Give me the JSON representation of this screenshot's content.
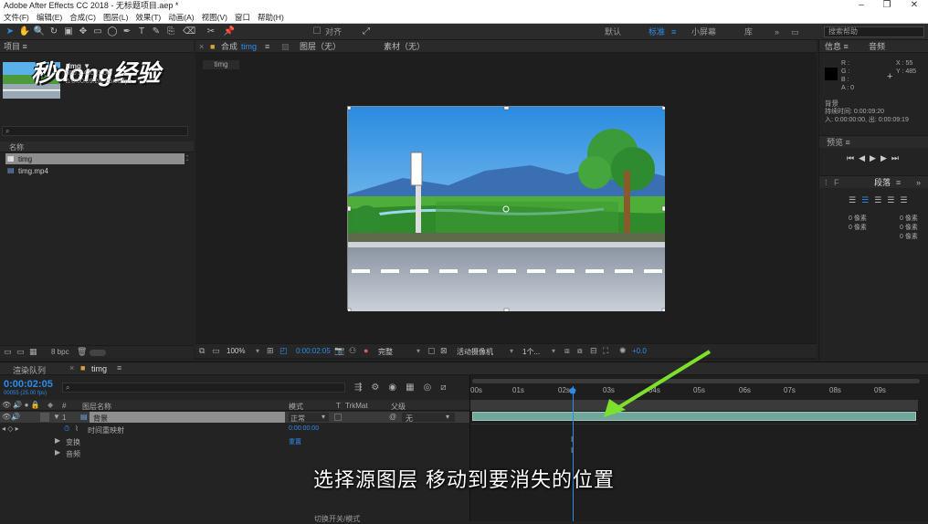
{
  "window": {
    "title": "Adobe After Effects CC 2018 - 无标题项目.aep *"
  },
  "menu": [
    "文件(F)",
    "编辑(E)",
    "合成(C)",
    "图层(L)",
    "效果(T)",
    "动画(A)",
    "视图(V)",
    "窗口",
    "帮助(H)"
  ],
  "toolbar": {
    "align_label": "对齐",
    "workspaces": [
      "默认",
      "标准",
      "小屏幕",
      "库"
    ],
    "search_placeholder": "搜索帮助"
  },
  "project": {
    "tab": "项目",
    "item_name": "timg ▼",
    "item_dims": "650 x 420 (1.00)",
    "item_dur": "Δ 0:00:09:20, 25.00 fps",
    "name_header": "名称",
    "items": [
      "timg",
      "timg.mp4"
    ],
    "bpc": "8 bpc"
  },
  "comp": {
    "tab": "合成",
    "comp_name": "timg",
    "layer_tab": "图层（无）",
    "footage_tab": "素材（无）",
    "subtab": "timg",
    "zoom": "100%",
    "timecode": "0:00:02:05",
    "quality": "完整",
    "camera": "活动摄像机",
    "view": "1个...",
    "exposure": "+0.0"
  },
  "info": {
    "tab": "信息",
    "audio_tab": "音频",
    "r": "R :",
    "g": "G :",
    "b": "B :",
    "a": "A : 0",
    "x": "X : 55",
    "y": "Y : 485",
    "layer": "背景",
    "duration": "持续时间: 0:00:09:20",
    "inout": "入: 0:00:00:00, 出: 0:00:09:19"
  },
  "preview": {
    "tab": "预览"
  },
  "paragraph": {
    "tab": "段落",
    "px1": "0 像素",
    "px2": "0 像素",
    "px3": "0 像素",
    "px4": "0 像素",
    "px5": "0 像素"
  },
  "timeline": {
    "render_tab": "渲染队列",
    "comp_tab": "timg",
    "current_time": "0:00:02:05",
    "fps": "00055 (25.00 fps)",
    "col_name": "图层名称",
    "col_mode": "模式",
    "col_t": "T",
    "col_trkmat": "TrkMat",
    "col_parent": "父级",
    "layer_num": "1",
    "layer_name": "背景",
    "layer_mode": "正常",
    "layer_parent": "无",
    "remap": "时间重映射",
    "remap_value": "0:00:00:00",
    "transform": "变换",
    "transform_link": "重置",
    "audio": "音频",
    "ruler": [
      "00s",
      "01s",
      "02s",
      "03s",
      "04s",
      "05s",
      "06s",
      "07s",
      "08s",
      "09s"
    ],
    "footer": "切换开关/模式"
  },
  "caption": "选择源图层 移动到要消失的位置",
  "watermark": "秒dong经验"
}
